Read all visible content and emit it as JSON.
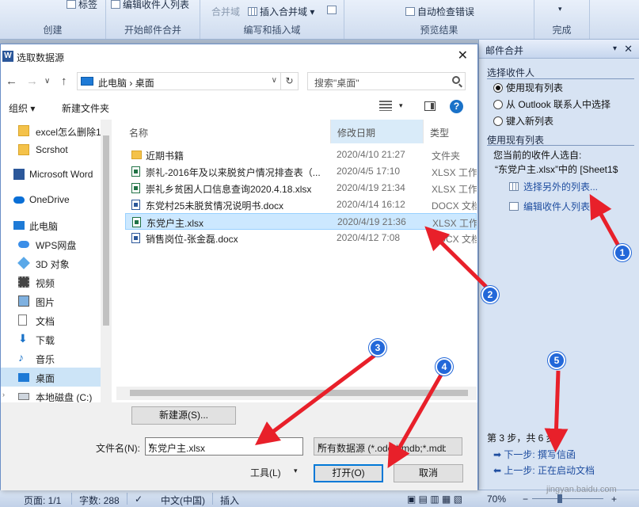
{
  "ribbon": {
    "top_buttons": {
      "labels": "标签",
      "edit_list": "编辑收件人列表",
      "merge_field": "合并域",
      "insert_merge_field": "插入合并域",
      "auto_check": "自动检查错误"
    },
    "groups": {
      "create": "创建",
      "start_merge": "开始邮件合并",
      "write_insert": "编写和插入域",
      "preview": "预览结果",
      "finish": "完成"
    }
  },
  "dialog": {
    "title": "选取数据源",
    "close": "✕",
    "nav": {
      "back": "←",
      "forward": "→",
      "dropdown": "∨",
      "up": "↑"
    },
    "address": {
      "root": "此电脑",
      "sep": "›",
      "current": "桌面",
      "dropdown": "∨",
      "refresh": "↻"
    },
    "search_placeholder": "搜索\"桌面\"",
    "toolbar": {
      "organize": "组织 ▾",
      "new_folder": "新建文件夹",
      "help": "?",
      "view_dd": "▾"
    },
    "nav_items": [
      {
        "label": "excel怎么删除1",
        "icon": "folder-icon"
      },
      {
        "label": "Scrshot",
        "icon": "folder-icon"
      },
      {
        "label": "Microsoft Word",
        "icon": "word-icon"
      },
      {
        "label": "OneDrive",
        "icon": "cloud-icon"
      },
      {
        "label": "此电脑",
        "icon": "computer-icon"
      },
      {
        "label": "WPS网盘",
        "icon": "cloud-icon"
      },
      {
        "label": "3D 对象",
        "icon": "cube-icon"
      },
      {
        "label": "视频",
        "icon": "video-icon"
      },
      {
        "label": "图片",
        "icon": "picture-icon"
      },
      {
        "label": "文档",
        "icon": "document-icon"
      },
      {
        "label": "下载",
        "icon": "download-icon"
      },
      {
        "label": "音乐",
        "icon": "music-icon"
      },
      {
        "label": "桌面",
        "icon": "desktop-icon"
      },
      {
        "label": "本地磁盘 (C:)",
        "icon": "drive-icon"
      }
    ],
    "columns": {
      "name": "名称",
      "date": "修改日期",
      "type": "类型"
    },
    "files": [
      {
        "name": "近期书籍",
        "date": "2020/4/10 21:27",
        "type": "文件夹",
        "kind": "folder"
      },
      {
        "name": "崇礼-2016年及以来脱贫户情况排查表（...",
        "date": "2020/4/5 17:10",
        "type": "XLSX 工作表",
        "kind": "xlsx"
      },
      {
        "name": "崇礼乡贫困人口信息查询2020.4.18.xlsx",
        "date": "2020/4/19 21:34",
        "type": "XLSX 工作表",
        "kind": "xlsx"
      },
      {
        "name": "东党村25未脱贫情况说明书.docx",
        "date": "2020/4/14 16:12",
        "type": "DOCX 文档",
        "kind": "docx"
      },
      {
        "name": "东党户主.xlsx",
        "date": "2020/4/19 21:36",
        "type": "XLSX 工作表",
        "kind": "xlsx",
        "selected": true
      },
      {
        "name": "销售岗位-张金磊.docx",
        "date": "2020/4/12 7:08",
        "type": "DOCX 文档",
        "kind": "docx"
      }
    ],
    "new_source": "新建源(S)...",
    "filename_label": "文件名(N):",
    "filename_value": "东党户主.xlsx",
    "filetype_value": "所有数据源 (*.odc;*.mdb;*.mdb",
    "tools": "工具(L)",
    "open": "打开(O)",
    "cancel": "取消",
    "dd": "∨",
    "dd_small": "▾"
  },
  "taskpane": {
    "title": "邮件合并",
    "dropdown": "▾",
    "close": "✕",
    "select_recipients": "选择收件人",
    "options": [
      {
        "label": "使用现有列表",
        "selected": true
      },
      {
        "label": "从 Outlook 联系人中选择",
        "selected": false
      },
      {
        "label": "键入新列表",
        "selected": false
      }
    ],
    "use_existing": "使用现有列表",
    "current_from": "您当前的收件人选自:",
    "current_source": "“东党户主.xlsx”中的 [Sheet1$",
    "select_another": "选择另外的列表...",
    "edit_list": "编辑收件人列表...",
    "step": "第 3 步，共 6 步",
    "next": "下一步: 撰写信函",
    "prev": "上一步: 正在启动文档"
  },
  "statusbar": {
    "page": "页面: 1/1",
    "words": "字数: 288",
    "lang": "中文(中国)",
    "insert": "插入",
    "zoom": "70%",
    "minus": "−",
    "plus": "+"
  },
  "annotations": [
    "1",
    "2",
    "3",
    "4",
    "5"
  ],
  "watermark": "jingyan.baidu.com",
  "colors": {
    "arrow": "#e8202a",
    "badge": "#2368d9",
    "selected_row": "#cce8ff"
  }
}
